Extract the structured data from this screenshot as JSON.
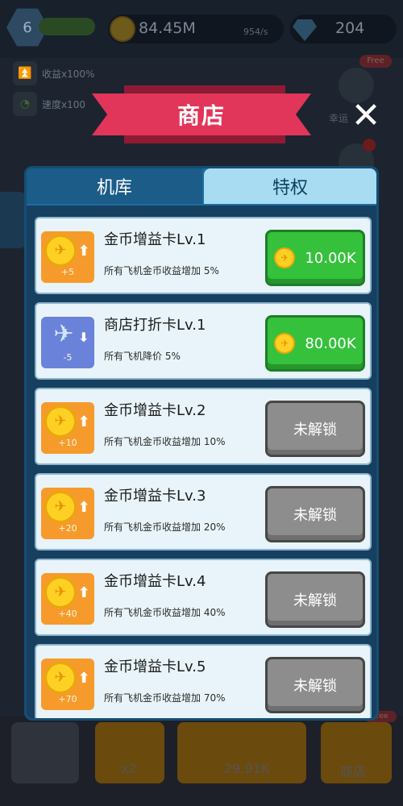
{
  "hud": {
    "level": "6",
    "coins": "84.45M",
    "coin_rate": "954/s",
    "gems": "204",
    "buffs": [
      {
        "label": "收益x100%"
      },
      {
        "label": "速度x100"
      }
    ],
    "side_free": "Free",
    "side_lucky": "幸运"
  },
  "bottom": {
    "speed_label": "x2",
    "buy_price": "29.91K",
    "shop_label": "商店",
    "free_tag": "Free"
  },
  "shop": {
    "title": "商店",
    "close_glyph": "✕",
    "tabs": [
      {
        "label": "机库",
        "active": false
      },
      {
        "label": "特权",
        "active": true
      }
    ],
    "items": [
      {
        "title": "金币增益卡Lv.1",
        "desc": "所有飞机金币收益增加 5%",
        "bonus": "+5",
        "icon": "coin-boost-icon",
        "status": "buy",
        "price": "10.00K"
      },
      {
        "title": "商店打折卡Lv.1",
        "desc": "所有飞机降价 5%",
        "bonus": "-5",
        "icon": "plane-discount-icon",
        "status": "buy",
        "price": "80.00K"
      },
      {
        "title": "金币增益卡Lv.2",
        "desc": "所有飞机金币收益增加 10%",
        "bonus": "+10",
        "icon": "coin-boost-icon",
        "status": "locked",
        "price": "未解锁"
      },
      {
        "title": "金币增益卡Lv.3",
        "desc": "所有飞机金币收益增加 20%",
        "bonus": "+20",
        "icon": "coin-boost-icon",
        "status": "locked",
        "price": "未解锁"
      },
      {
        "title": "金币增益卡Lv.4",
        "desc": "所有飞机金币收益增加 40%",
        "bonus": "+40",
        "icon": "coin-boost-icon",
        "status": "locked",
        "price": "未解锁"
      },
      {
        "title": "金币增益卡Lv.5",
        "desc": "所有飞机金币收益增加 70%",
        "bonus": "+70",
        "icon": "coin-boost-icon",
        "status": "locked",
        "price": "未解锁"
      }
    ]
  },
  "colors": {
    "buy_button": "#35c13b",
    "locked_button": "#8d8d8d",
    "ribbon": "#e2355a",
    "panel": "#1d6ea0"
  }
}
